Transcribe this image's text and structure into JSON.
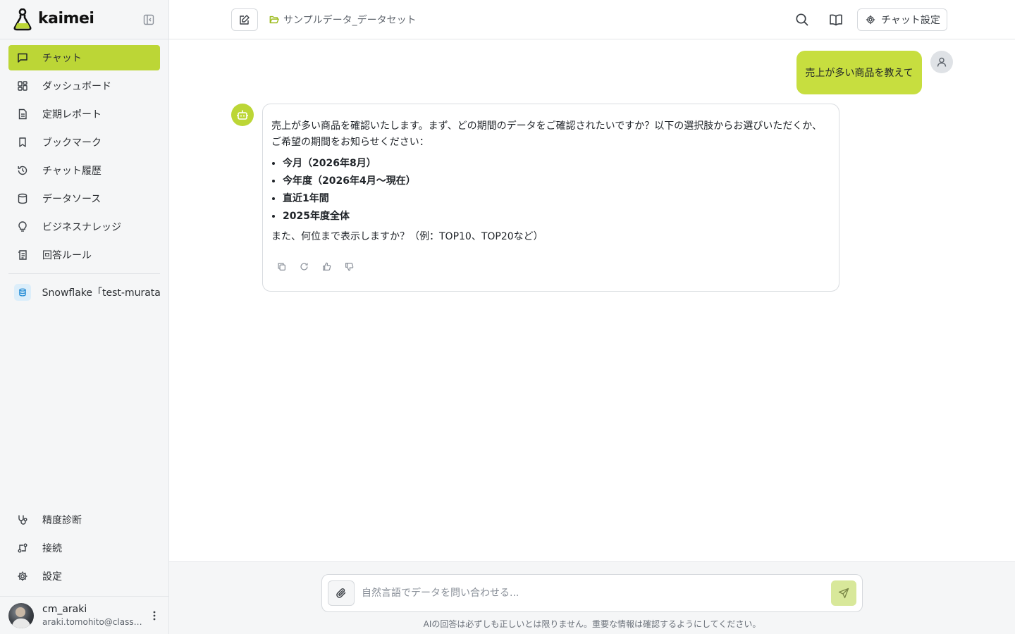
{
  "brand": {
    "name": "kaimei"
  },
  "sidebar": {
    "items": [
      {
        "label": "チャット",
        "icon": "chat-icon",
        "active": true
      },
      {
        "label": "ダッシュボード",
        "icon": "dashboard-icon"
      },
      {
        "label": "定期レポート",
        "icon": "report-icon"
      },
      {
        "label": "ブックマーク",
        "icon": "bookmark-icon"
      },
      {
        "label": "チャット履歴",
        "icon": "history-icon"
      },
      {
        "label": "データソース",
        "icon": "database-icon"
      },
      {
        "label": "ビジネスナレッジ",
        "icon": "lightbulb-icon"
      },
      {
        "label": "回答ルール",
        "icon": "rules-icon"
      }
    ],
    "source": {
      "label": "Snowflake「test-murata」"
    },
    "bottom_items": [
      {
        "label": "精度診断",
        "icon": "stethoscope-icon"
      },
      {
        "label": "接続",
        "icon": "connection-icon"
      },
      {
        "label": "設定",
        "icon": "gear-icon"
      }
    ],
    "user": {
      "name": "cm_araki",
      "email": "araki.tomohito@classmethod.jp"
    }
  },
  "header": {
    "dataset": "サンプルデータ_データセット",
    "settings_label": "チャット設定"
  },
  "chat": {
    "user_message": "売上が多い商品を教えて",
    "bot_intro": "売上が多い商品を確認いたします。まず、どの期間のデータをご確認されたいですか？以下の選択肢からお選びいただくか、ご希望の期間をお知らせください：",
    "options": [
      "今月（2026年8月）",
      "今年度（2026年4月〜現在）",
      "直近1年間",
      "2025年度全体"
    ],
    "bot_followup": "また、何位まで表示しますか？（例：TOP10、TOP20など）"
  },
  "composer": {
    "placeholder": "自然言語でデータを問い合わせる...",
    "disclaimer": "AIの回答は必ずしも正しいとは限りません。重要な情報は確認するようにしてください。"
  },
  "colors": {
    "accent": "#bcd636",
    "user_bubble": "#c7de3f",
    "send_disabled": "#d8e89a"
  }
}
